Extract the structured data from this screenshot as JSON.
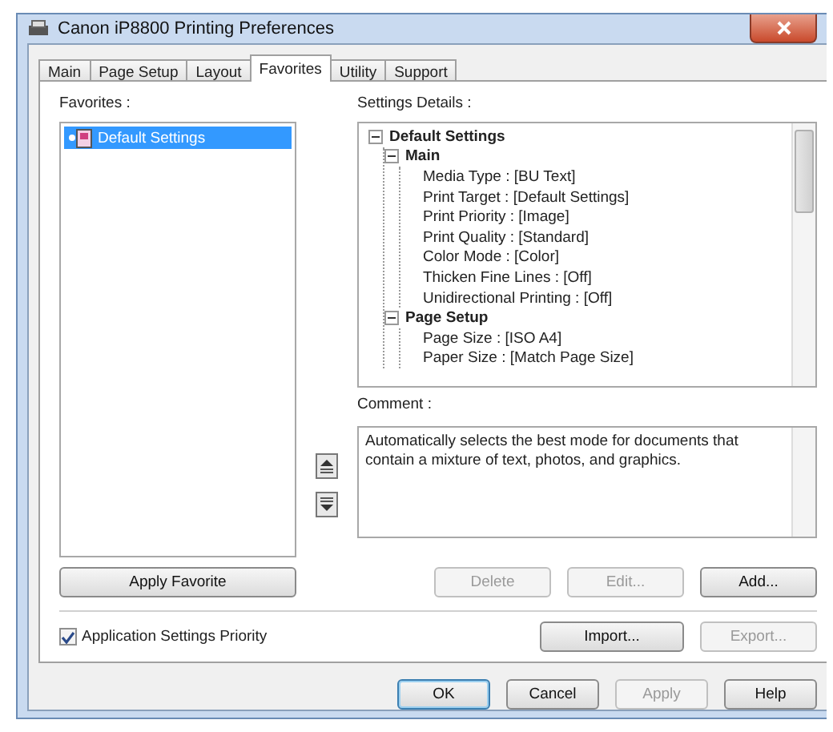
{
  "window": {
    "title": "Canon iP8800 Printing Preferences"
  },
  "tabs": [
    {
      "label": "Main",
      "selected": false
    },
    {
      "label": "Page Setup",
      "selected": false
    },
    {
      "label": "Layout",
      "selected": false
    },
    {
      "label": "Favorites",
      "selected": true
    },
    {
      "label": "Utility",
      "selected": false
    },
    {
      "label": "Support",
      "selected": false
    }
  ],
  "favorites": {
    "label": "Favorites :",
    "items": [
      {
        "label": "Default Settings",
        "selected": true
      }
    ],
    "apply_button": "Apply Favorite"
  },
  "settings_details": {
    "label": "Settings Details :",
    "tree": [
      {
        "label": "Default Settings",
        "expanded": true,
        "children": [
          {
            "label": "Main",
            "expanded": true,
            "children": [
              {
                "label": "Media Type : [BU Text]"
              },
              {
                "label": "Print Target : [Default Settings]"
              },
              {
                "label": "Print Priority : [Image]"
              },
              {
                "label": "Print Quality : [Standard]"
              },
              {
                "label": "Color Mode : [Color]"
              },
              {
                "label": "Thicken Fine Lines : [Off]"
              },
              {
                "label": "Unidirectional Printing : [Off]"
              }
            ]
          },
          {
            "label": "Page Setup",
            "expanded": true,
            "children": [
              {
                "label": "Page Size : [ISO A4]"
              },
              {
                "label": "Paper Size : [Match Page Size]"
              }
            ]
          }
        ]
      }
    ]
  },
  "comment": {
    "label": "Comment :",
    "value": "Automatically selects the best mode for documents that contain a mixture of text, photos, and graphics."
  },
  "edit_buttons": [
    {
      "label": "Delete",
      "disabled": true
    },
    {
      "label": "Edit...",
      "disabled": true
    },
    {
      "label": "Add...",
      "disabled": false
    }
  ],
  "application_priority": {
    "label": "Application Settings Priority",
    "checked": true
  },
  "io_buttons": [
    {
      "label": "Import...",
      "disabled": false
    },
    {
      "label": "Export...",
      "disabled": true
    }
  ],
  "dialog_buttons": [
    {
      "label": "OK",
      "disabled": false,
      "default": true
    },
    {
      "label": "Cancel",
      "disabled": false,
      "default": false
    },
    {
      "label": "Apply",
      "disabled": true,
      "default": false
    },
    {
      "label": "Help",
      "disabled": false,
      "default": false
    }
  ]
}
